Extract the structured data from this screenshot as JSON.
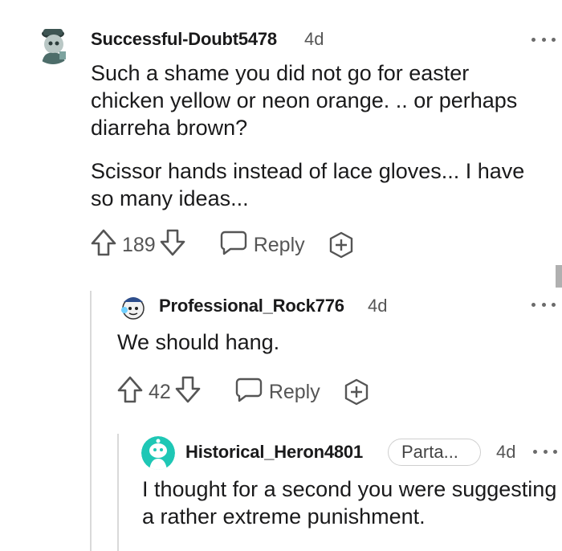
{
  "comments": [
    {
      "username": "Successful-Doubt5478",
      "time": "4d",
      "paragraphs": [
        "Such a shame you did not go for easter chicken yellow or neon orange. .. or perhaps diarreha brown?",
        "Scissor hands instead of lace gloves... I have so many ideas..."
      ],
      "upvotes": "189",
      "reply_label": "Reply"
    },
    {
      "username": "Professional_Rock776",
      "time": "4d",
      "paragraphs": [
        "We should hang."
      ],
      "upvotes": "42",
      "reply_label": "Reply"
    },
    {
      "username": "Historical_Heron4801",
      "flair": "Parta...",
      "time": "4d",
      "paragraphs": [
        "I thought for a second you were suggesting a rather extreme punishment."
      ]
    }
  ],
  "colors": {
    "accent_teal": "#1ec7b5",
    "icon_gray": "#555555",
    "thread_line": "#d9d9d9"
  },
  "icons": [
    "upvote-icon",
    "downvote-icon",
    "reply-bubble-icon",
    "award-plus-icon",
    "more-options-icon"
  ]
}
